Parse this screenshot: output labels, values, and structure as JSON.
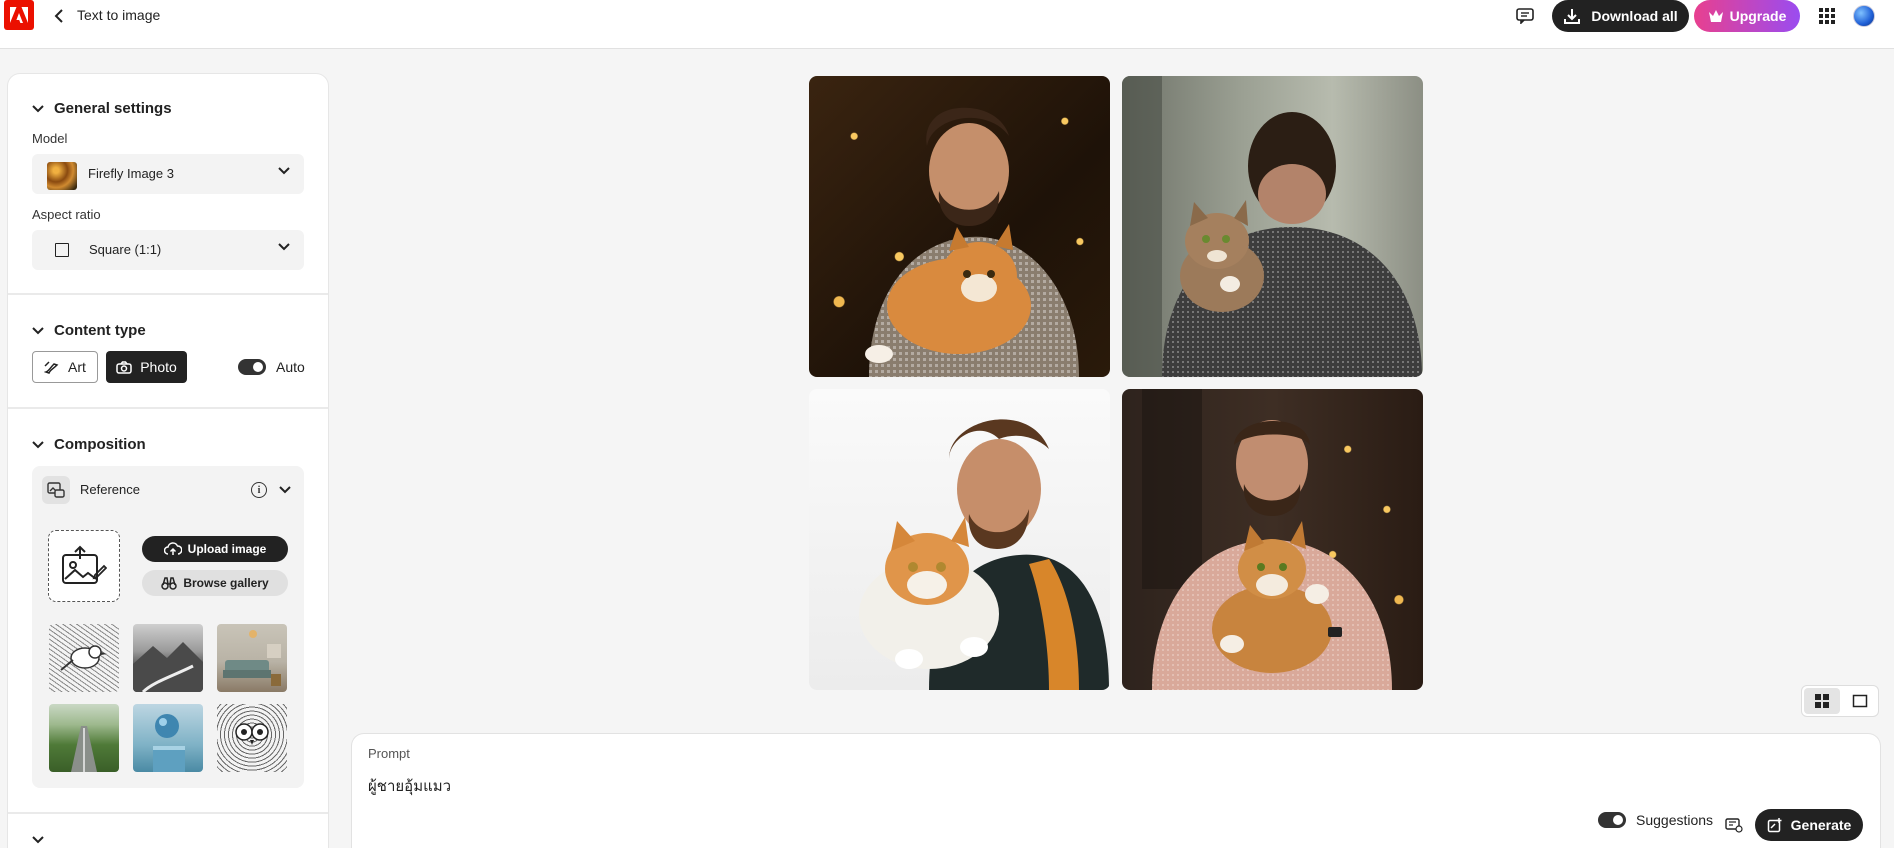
{
  "header": {
    "title": "Text to image",
    "download_label": "Download all",
    "upgrade_label": "Upgrade"
  },
  "sidebar": {
    "general": {
      "title": "General settings",
      "model_label": "Model",
      "model_value": "Firefly Image 3",
      "aspect_label": "Aspect ratio",
      "aspect_value": "Square (1:1)"
    },
    "content_type": {
      "title": "Content type",
      "art_label": "Art",
      "photo_label": "Photo",
      "auto_label": "Auto",
      "selected": "Photo",
      "auto_enabled": true
    },
    "composition": {
      "title": "Composition",
      "reference_label": "Reference",
      "upload_label": "Upload image",
      "gallery_label": "Browse gallery",
      "thumbnails": [
        "bird-sketch",
        "mountain-road",
        "living-room",
        "green-field-road",
        "blue-sphere",
        "owl-sketch"
      ]
    }
  },
  "main": {
    "images": [
      "man-with-cat-bokeh",
      "man-back-with-cat",
      "man-jacket-with-cat",
      "man-sweater-with-cat"
    ],
    "view_mode": "grid"
  },
  "prompt": {
    "label": "Prompt",
    "value": "ผู้ชายอุ้มแมว",
    "suggestions_label": "Suggestions",
    "suggestions_enabled": true,
    "generate_label": "Generate"
  },
  "colors": {
    "brand": "#eb1000",
    "dark": "#222222",
    "upgrade_start": "#e8408f",
    "upgrade_end": "#9a4cf0"
  }
}
